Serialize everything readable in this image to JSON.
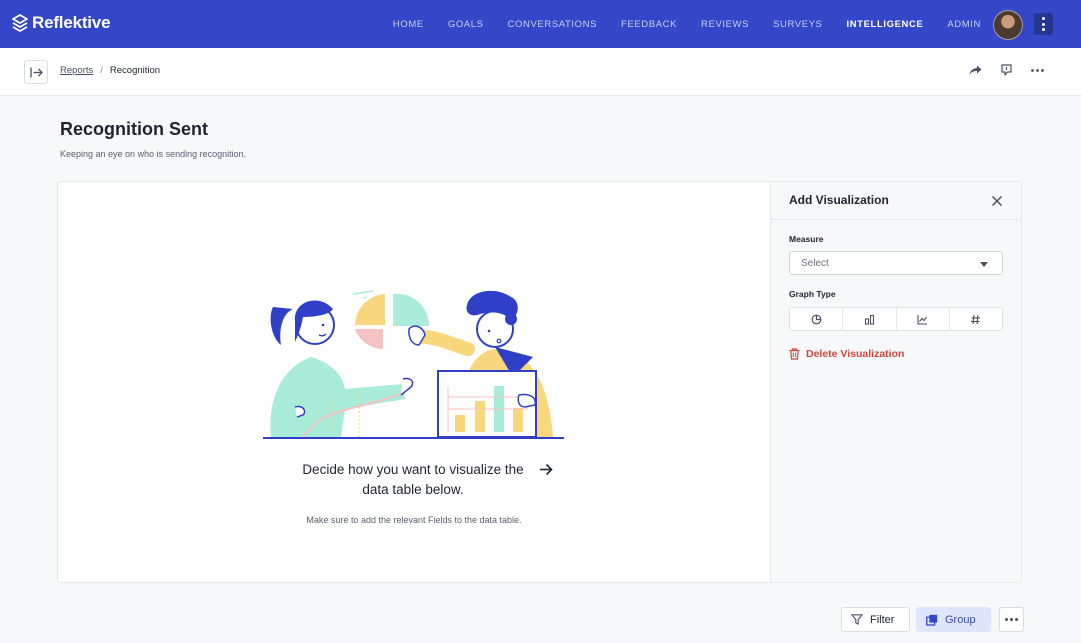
{
  "app": {
    "brand": "Reflektive"
  },
  "nav": {
    "items": [
      {
        "label": "HOME"
      },
      {
        "label": "GOALS"
      },
      {
        "label": "CONVERSATIONS"
      },
      {
        "label": "FEEDBACK"
      },
      {
        "label": "REVIEWS"
      },
      {
        "label": "SURVEYS"
      },
      {
        "label": "INTELLIGENCE",
        "active": true
      },
      {
        "label": "ADMIN"
      }
    ]
  },
  "breadcrumb": {
    "parent": "Reports",
    "separator": "/",
    "current": "Recognition"
  },
  "page": {
    "title": "Recognition Sent",
    "subtitle": "Keeping an eye on who is sending recognition."
  },
  "empty_state": {
    "message": "Decide how you want to visualize the data table below.",
    "hint": "Make sure to add the relevant Fields to the data table."
  },
  "panel": {
    "title": "Add Visualization",
    "measure_label": "Measure",
    "measure_placeholder": "Select",
    "graph_type_label": "Graph Type",
    "graph_types": [
      "pie-chart-icon",
      "bar-chart-icon",
      "line-chart-icon",
      "number-icon"
    ],
    "delete_label": "Delete Visualization"
  },
  "actions": {
    "filter_label": "Filter",
    "group_label": "Group"
  },
  "colors": {
    "brand": "#3447c9",
    "danger": "#d0453b",
    "group_bg": "#dfe6fb"
  }
}
